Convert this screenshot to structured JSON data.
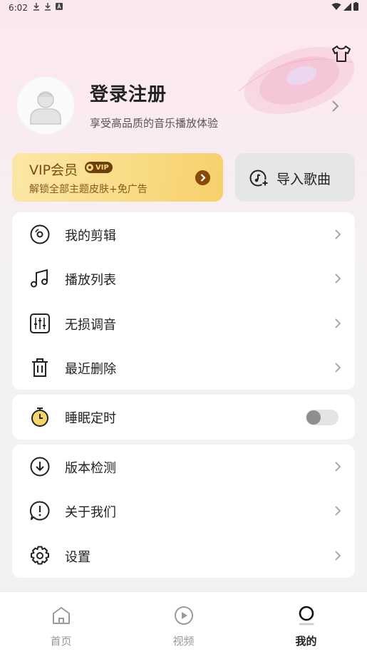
{
  "status_bar": {
    "time": "6:02"
  },
  "profile": {
    "title": "登录注册",
    "subtitle": "享受高品质的音乐播放体验"
  },
  "vip": {
    "title": "VIP会员",
    "badge": "VIP",
    "subtitle": "解锁全部主题皮肤+免广告"
  },
  "import": {
    "label": "导入歌曲"
  },
  "menu_group_1": [
    {
      "label": "我的剪辑",
      "icon": "disc-icon"
    },
    {
      "label": "播放列表",
      "icon": "music-note-icon"
    },
    {
      "label": "无损调音",
      "icon": "equalizer-icon"
    },
    {
      "label": "最近删除",
      "icon": "trash-icon"
    }
  ],
  "sleep_timer": {
    "label": "睡眠定时",
    "enabled": false,
    "accent": "#f5d56a"
  },
  "menu_group_3": [
    {
      "label": "版本检测",
      "icon": "download-circle-icon"
    },
    {
      "label": "关于我们",
      "icon": "info-bubble-icon"
    },
    {
      "label": "设置",
      "icon": "gear-icon"
    }
  ],
  "bottom_nav": [
    {
      "label": "首页",
      "icon": "home-icon",
      "active": false
    },
    {
      "label": "视频",
      "icon": "play-circle-icon",
      "active": false
    },
    {
      "label": "我的",
      "icon": "profile-icon",
      "active": true
    }
  ],
  "colors": {
    "vip_gold": "#f9dc86",
    "vip_text": "#7a4a12",
    "background": "#f2f2f4"
  }
}
